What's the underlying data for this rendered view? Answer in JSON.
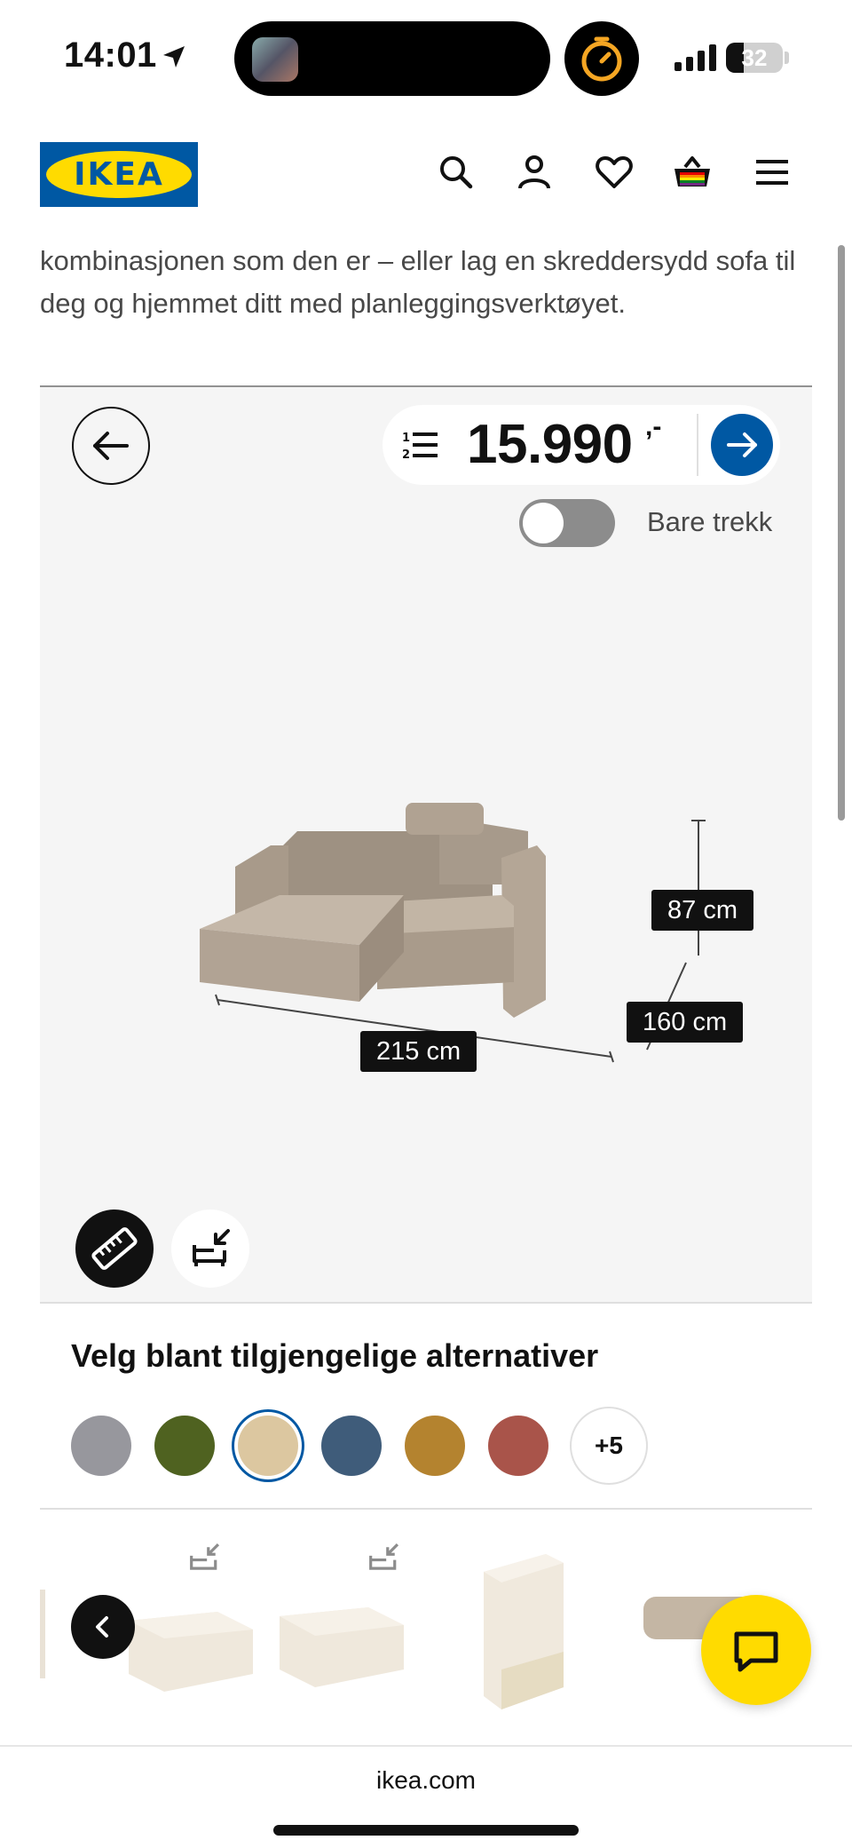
{
  "status_bar": {
    "time": "14:01",
    "battery_level": "32"
  },
  "header": {
    "logo_text": "IKEA",
    "icons": [
      "search-icon",
      "profile-icon",
      "heart-icon",
      "basket-icon",
      "menu-icon"
    ]
  },
  "intro": {
    "text": "kombinasjonen som den er – eller lag en skreddersydd sofa til deg og hjemmet ditt med planleggingsverktøyet."
  },
  "configurator": {
    "price": "15.990",
    "price_suffix": ",-",
    "toggle_label": "Bare trekk",
    "toggle_on": false,
    "dimensions": {
      "height": "87 cm",
      "depth": "160 cm",
      "width": "215 cm"
    }
  },
  "options": {
    "title": "Velg blant tilgjengelige alternativer",
    "swatches": [
      "#97979d",
      "#4f6220",
      "#dcc7a0",
      "#3f5c7a",
      "#b4832f",
      "#a9544a"
    ],
    "selected_swatch_index": 2,
    "more_label": "+5"
  },
  "browser": {
    "url": "ikea.com"
  },
  "colors": {
    "ikea_blue": "#0058a3",
    "ikea_yellow": "#ffdb00"
  }
}
